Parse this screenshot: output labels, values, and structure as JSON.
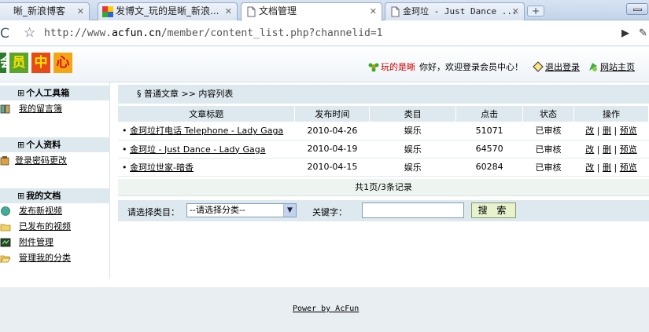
{
  "browser": {
    "tabs": [
      {
        "title": "晰_新浪博客"
      },
      {
        "title": "发博文_玩的是晰_新浪..."
      },
      {
        "title": "文档管理"
      },
      {
        "title": "金珂垃 - Just Dance ..."
      }
    ],
    "url_prefix": "http://www.",
    "url_host": "acfun.cn",
    "url_path": "/member/content_list.php?channelid=1",
    "new_tab": "+"
  },
  "header": {
    "logo_chars": [
      "会",
      "员",
      "中",
      "心"
    ],
    "username": "玩的是晰",
    "greeting": "你好，欢迎登录会员中心！",
    "logout": "退出登录",
    "home": "网站主页"
  },
  "sidebar": {
    "sections": [
      {
        "title": "个人工具箱",
        "items": [
          {
            "label": "我的留言簿"
          }
        ]
      },
      {
        "title": "个人资料",
        "items": [
          {
            "label": "登录密码更改"
          }
        ]
      },
      {
        "title": "我的文档",
        "items": [
          {
            "label": "发布新视频"
          },
          {
            "label": "已发布的视频"
          },
          {
            "label": "附件管理"
          },
          {
            "label": "管理我的分类"
          }
        ]
      }
    ],
    "box_glyph": "⊞"
  },
  "main": {
    "breadcrumb": "§  普通文章 >> 内容列表",
    "columns": [
      "文章标题",
      "发布时间",
      "类目",
      "点击",
      "状态",
      "操作"
    ],
    "rows": [
      {
        "title": "金珂垃打电话 Telephone - Lady Gaga",
        "date": "2010-04-26",
        "category": "娱乐",
        "clicks": "51071",
        "status": "已审核"
      },
      {
        "title": "金珂垃 - Just Dance - Lady Gaga",
        "date": "2010-04-19",
        "category": "娱乐",
        "clicks": "64570",
        "status": "已审核"
      },
      {
        "title": "金珂垃世家-暗香",
        "date": "2010-04-15",
        "category": "娱乐",
        "clicks": "60284",
        "status": "已审核"
      }
    ],
    "ops": {
      "edit": "改",
      "delete": "删",
      "preview": "预览",
      "sep": "|"
    },
    "bullet": "•",
    "pager": "共1页/3条记录",
    "search": {
      "category_label": "请选择类目：",
      "category_value": "--请选择分类--",
      "keyword_label": "关键字：",
      "keyword_value": "",
      "button": "搜 索"
    }
  },
  "footer": {
    "text": "Power by AcFun"
  }
}
